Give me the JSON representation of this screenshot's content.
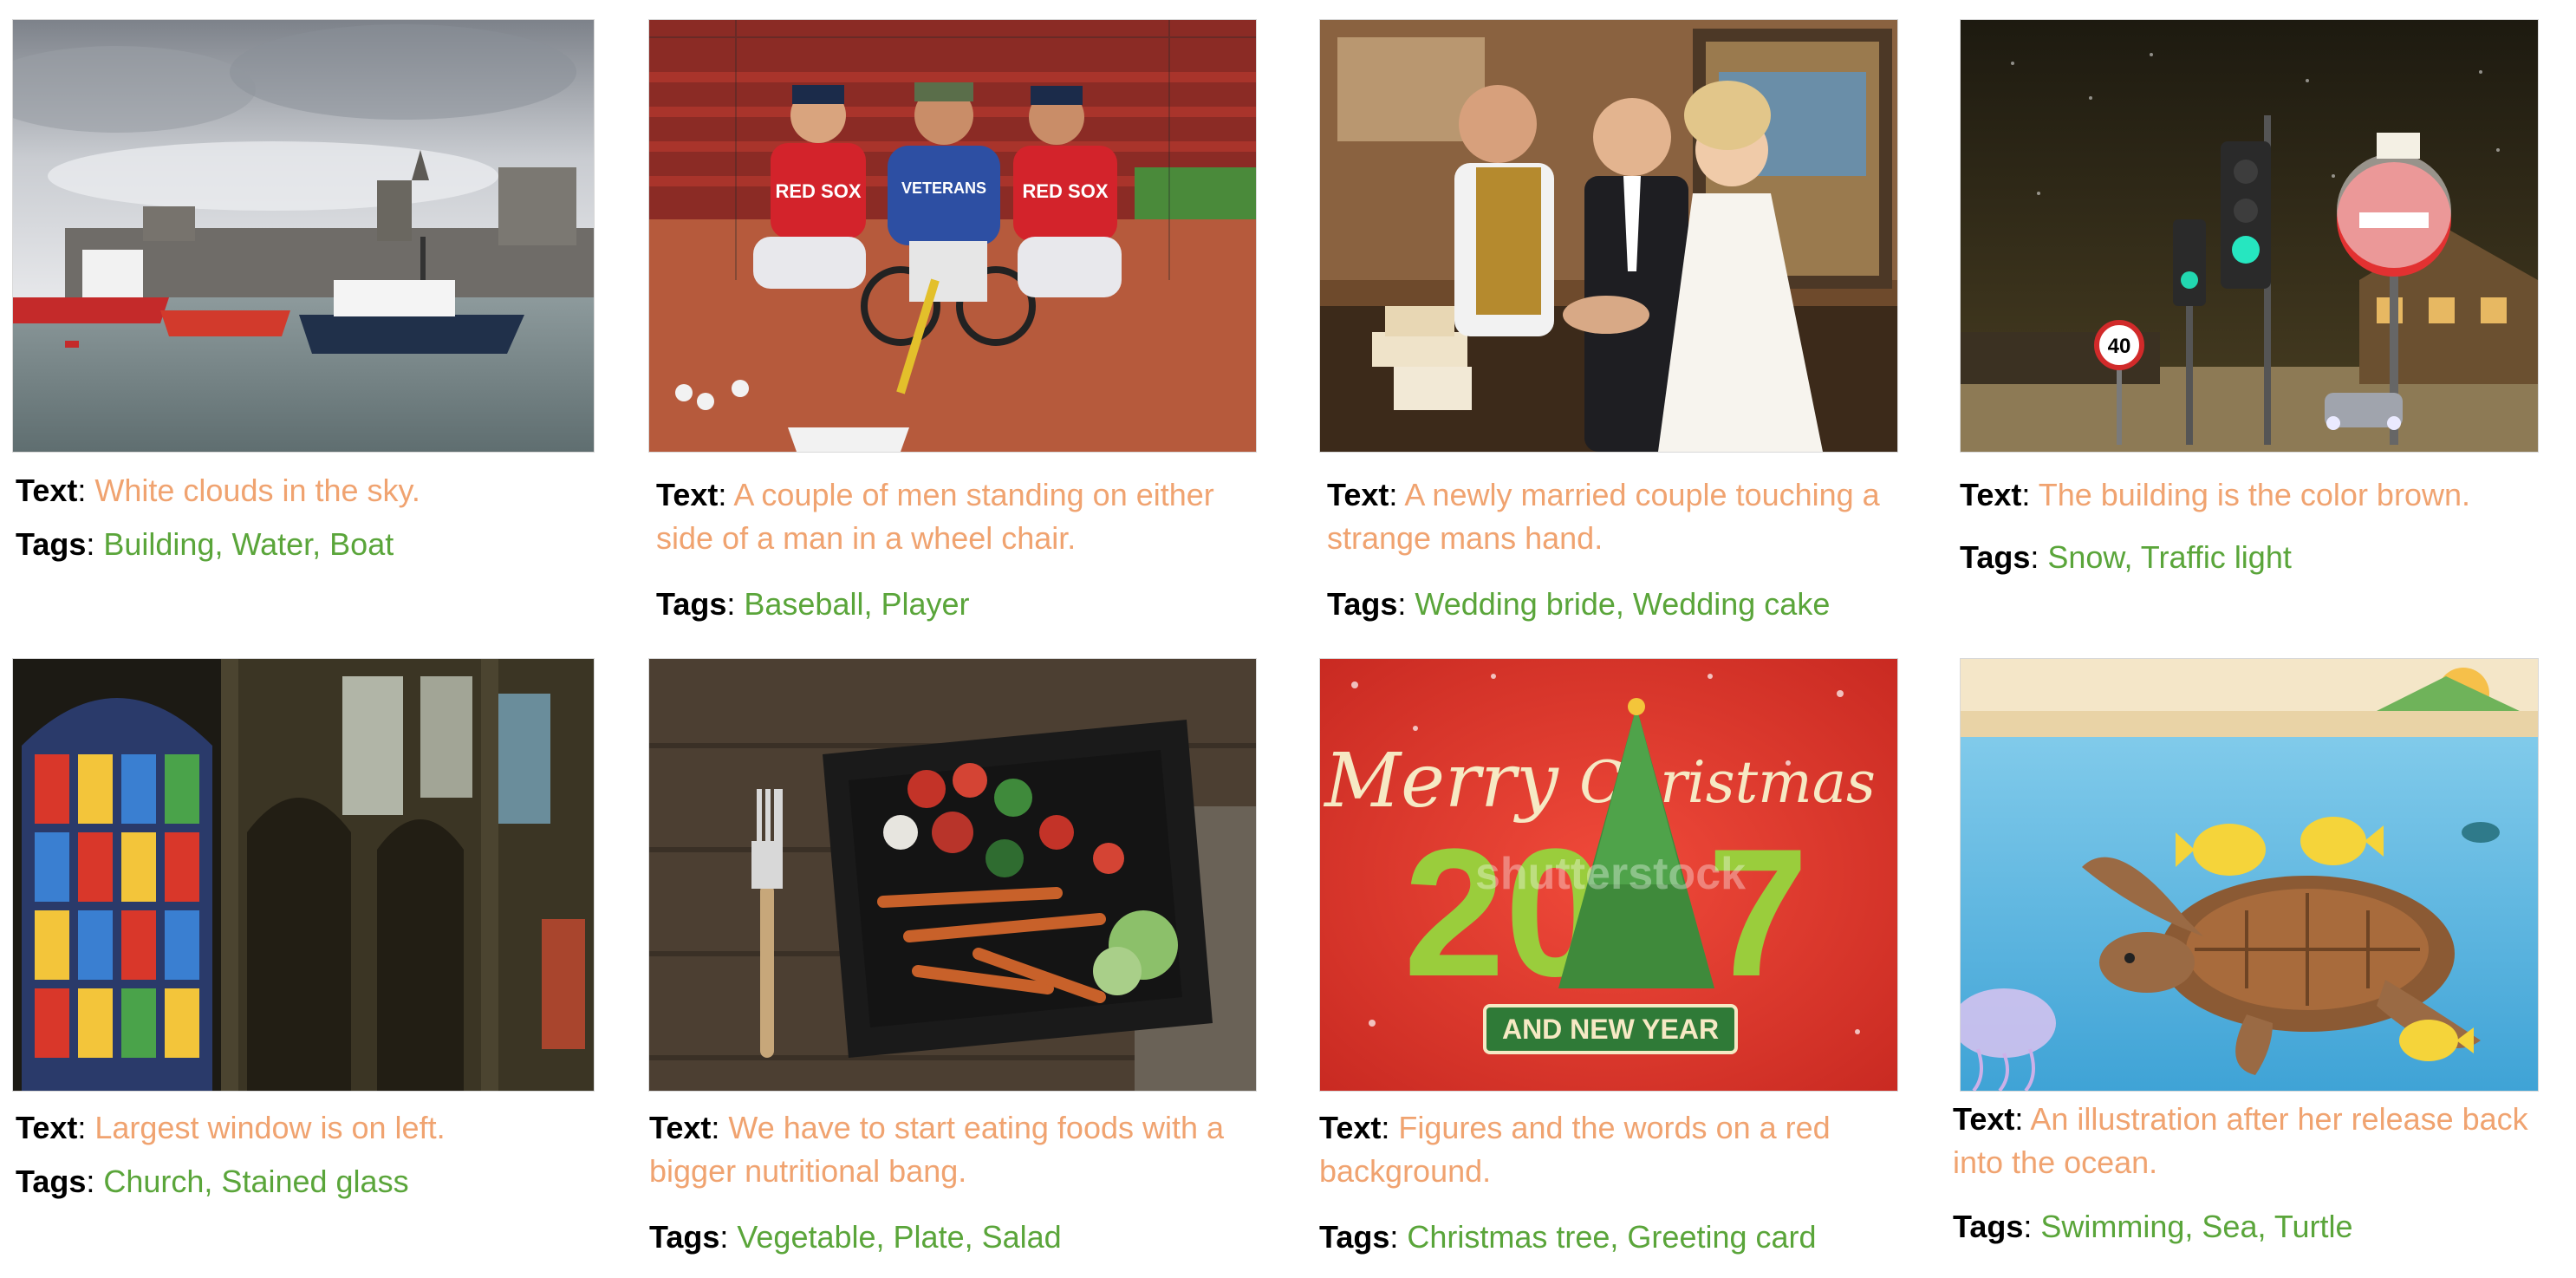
{
  "colors": {
    "text_label": "#000000",
    "caption": "#f0a370",
    "tags": "#5aa53a"
  },
  "cards": [
    {
      "image_name": "harbor-photo",
      "text_label": "Text",
      "tags_label": "Tags",
      "text": "White clouds in the sky.",
      "tags": "Building, Water, Boat"
    },
    {
      "image_name": "baseball-players-photo",
      "text_label": "Text",
      "tags_label": "Tags",
      "text": "A couple of men standing on either side of a man in a wheel chair.",
      "tags": "Baseball, Player",
      "jersey_left": "RED SOX",
      "jersey_center": "VETERANS",
      "jersey_right": "RED SOX"
    },
    {
      "image_name": "wedding-photo",
      "text_label": "Text",
      "tags_label": "Tags",
      "text": "A newly married couple touching a strange mans hand.",
      "tags": "Wedding bride, Wedding cake"
    },
    {
      "image_name": "snowy-street-photo",
      "text_label": "Text",
      "tags_label": "Tags",
      "text": "The building is the color brown.",
      "tags": "Snow, Traffic light",
      "speed_sign": "40"
    },
    {
      "image_name": "church-interior-photo",
      "text_label": "Text",
      "tags_label": "Tags",
      "text": "Largest window is on left.",
      "tags": "Church, Stained glass"
    },
    {
      "image_name": "food-plate-photo",
      "text_label": "Text",
      "tags_label": "Tags",
      "text": "We have to start eating foods with a bigger nutritional bang.",
      "tags": "Vegetable, Plate, Salad"
    },
    {
      "image_name": "christmas-card-image",
      "text_label": "Text",
      "tags_label": "Tags",
      "text": "Figures and the words on a red background.",
      "tags": "Christmas tree, Greeting card",
      "card_merry": "Merry",
      "card_christmas": "Christmas",
      "card_year": "2017",
      "card_ribbon": "AND NEW YEAR",
      "card_watermark": "shutterstock"
    },
    {
      "image_name": "turtle-illustration",
      "text_label": "Text",
      "tags_label": "Tags",
      "text": "An illustration after her release back into the ocean.",
      "tags": "Swimming, Sea, Turtle"
    }
  ]
}
